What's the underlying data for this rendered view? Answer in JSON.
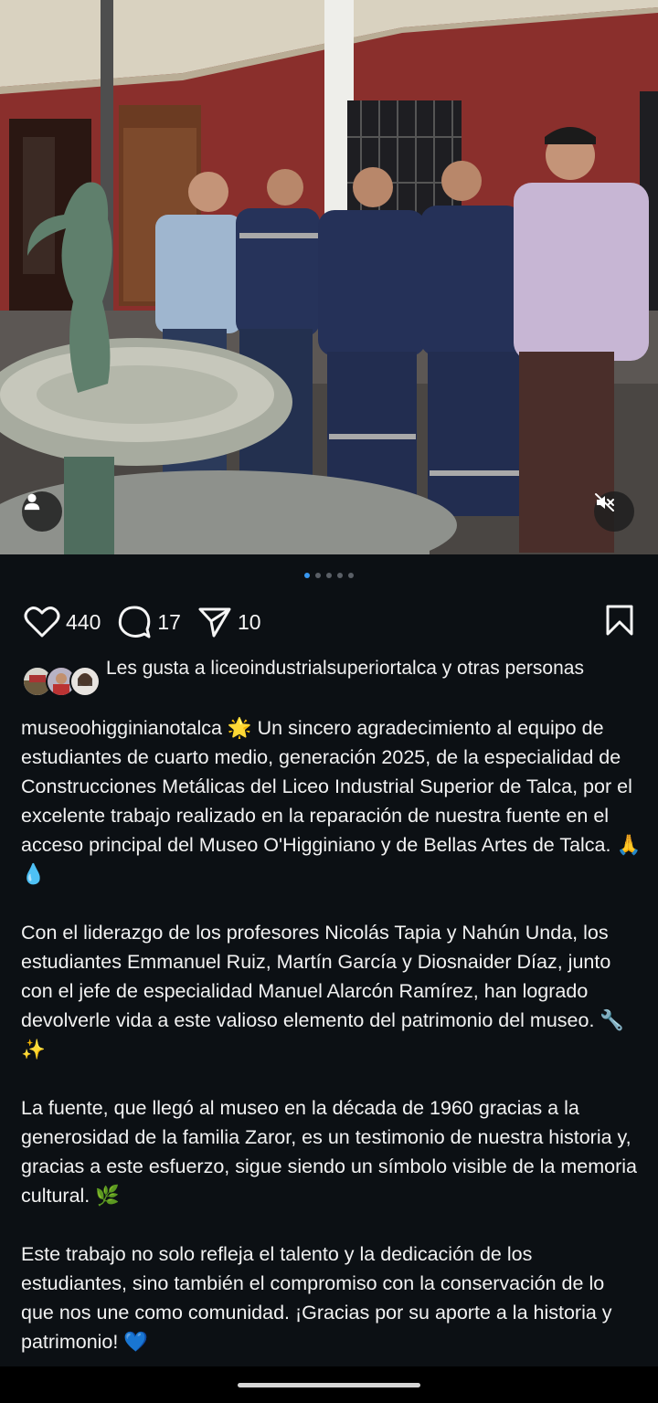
{
  "post": {
    "image_description_icon": "photo",
    "carousel": {
      "count": 5,
      "active_index": 0
    }
  },
  "actions": {
    "likes": "440",
    "comments": "17",
    "shares": "10"
  },
  "liked_by": {
    "text": "Les gusta a liceoindustrialsuperiortalca y otras personas"
  },
  "caption": {
    "username": "museoohigginianotalca",
    "p1": " 🌟 Un sincero agradecimiento al equipo de estudiantes de cuarto medio, generación 2025, de la especialidad de Construcciones Metálicas del Liceo Industrial Superior de Talca, por el excelente trabajo realizado en la reparación de nuestra fuente en el acceso principal del Museo O'Higginiano y de Bellas Artes de Talca. 🙏💧",
    "p2": "Con el liderazgo de los profesores Nicolás Tapia y Nahún Unda, los estudiantes Emmanuel Ruiz, Martín García y Diosnaider Díaz, junto con el jefe de especialidad Manuel Alarcón Ramírez, han logrado devolverle vida a este valioso elemento del patrimonio del museo. 🔧✨",
    "p3": "La fuente, que llegó al museo en la década de 1960 gracias a la generosidad de la familia Zaror, es un testimonio de nuestra historia y, gracias a este esfuerzo, sigue siendo un símbolo visible de la memoria cultural. 🌿",
    "p4": "Este trabajo no solo refleja el talento y la dedicación de los estudiantes, sino también el compromiso con la conservación de lo que nos une como comunidad. ¡Gracias por su aporte a la historia y patrimonio! 💙"
  },
  "colors": {
    "background": "#0c1014",
    "accent": "#3897f0",
    "text": "#f5f5f5"
  }
}
